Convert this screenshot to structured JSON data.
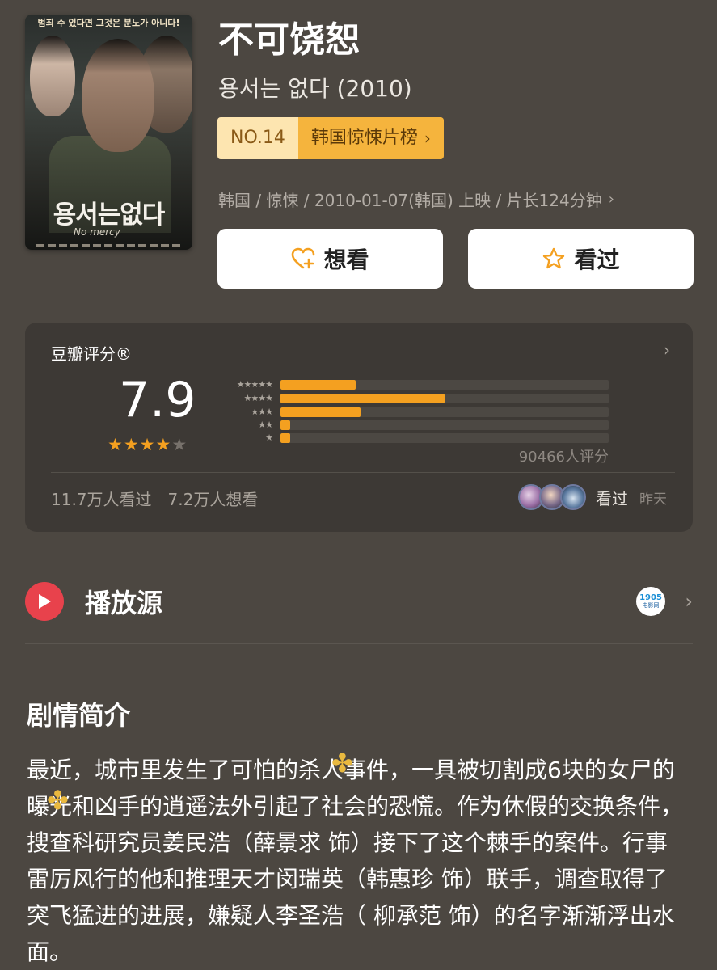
{
  "poster": {
    "tagline": "범죄 수 있다면 그것은 분노가 아니다!",
    "title_art": "용서는없다",
    "subtitle_art": "No mercy"
  },
  "movie": {
    "title": "不可饶恕",
    "original_title": "용서는 없다 (2010)",
    "rank_no": "NO.14",
    "rank_name": "韩国惊悚片榜",
    "meta": "韩国 / 惊悚 / 2010-01-07(韩国) 上映 / 片长124分钟"
  },
  "actions": {
    "want_label": "想看",
    "watched_label": "看过"
  },
  "rating": {
    "label": "豆瓣评分®",
    "score": "7.9",
    "stars_filled": 4,
    "stars_total": 5,
    "distribution": [
      {
        "stars": "★★★★★",
        "fraction": 0.23
      },
      {
        "stars": "★★★★",
        "fraction": 0.5
      },
      {
        "stars": "★★★",
        "fraction": 0.245
      },
      {
        "stars": "★★",
        "fraction": 0.03
      },
      {
        "stars": "★",
        "fraction": 0.03
      }
    ],
    "count": "90466人评分",
    "watched_count": "11.7万人看过",
    "want_count": "7.2万人想看",
    "friends_label": "看过",
    "friends_time": "昨天"
  },
  "source": {
    "label": "播放源",
    "logo_number": "1905",
    "logo_text": "电影网"
  },
  "synopsis": {
    "title": "剧情简介",
    "text": "最近，城市里发生了可怕的杀人事件，一具被切割成6块的女尸的曝光和凶手的逍遥法外引起了社会的恐慌。作为休假的交换条件，搜查科研究员姜民浩（薛景求 饰）接下了这个棘手的案件。行事雷厉风行的他和推理天才闵瑞英（韩惠珍 饰）联手，调查取得了突飞猛进的进展，嫌疑人李圣浩（ 柳承范 饰）的名字渐渐浮出水面。"
  },
  "colors": {
    "background": "#4c4741",
    "card": "#3d3935",
    "accent_orange": "#f4a020",
    "rank_light": "#fde5b0",
    "rank_dark": "#f5b43d",
    "play_red": "#e8424c"
  }
}
